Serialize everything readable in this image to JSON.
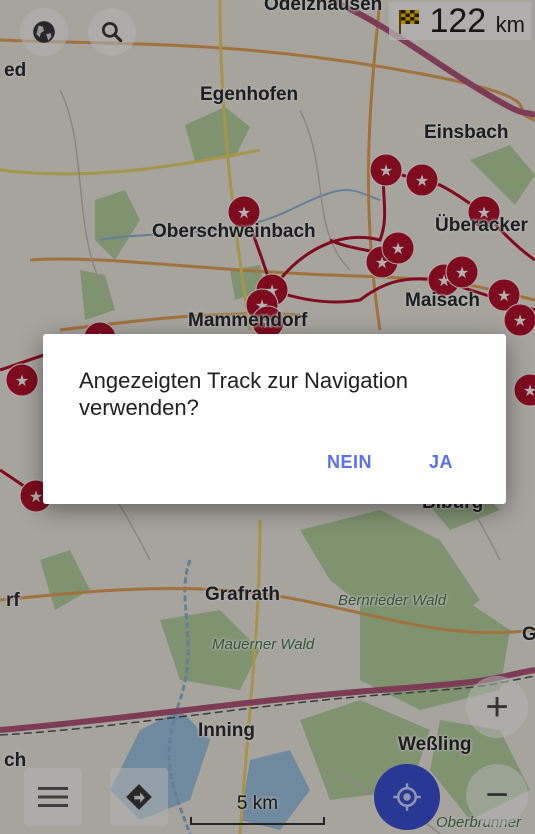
{
  "map": {
    "labels": [
      "Odelzhausen",
      "Egenhofen",
      "Einsbach",
      "Oberschweinbach",
      "Überacker",
      "Maisach",
      "Mammendorf",
      "Grafrath",
      "Bernrieder Wald",
      "Mauerner Wald",
      "Inning",
      "Weßling",
      "Oberbrunner",
      "ed",
      "rf",
      "ch",
      "G",
      "Biburg"
    ]
  },
  "toolbar": {
    "globe_icon": "globe-icon",
    "search_icon": "search-icon",
    "zoom_in_label": "+",
    "zoom_out_label": "−"
  },
  "distance": {
    "value": "122",
    "unit": "km"
  },
  "scale": {
    "label": "5 km"
  },
  "dialog": {
    "message": "Angezeigten Track zur Navigation verwenden?",
    "no_label": "NEIN",
    "yes_label": "JA"
  },
  "colors": {
    "accent": "#5b6ff2",
    "poi_marker": "#b5122c",
    "my_location": "#3b4fd6"
  }
}
